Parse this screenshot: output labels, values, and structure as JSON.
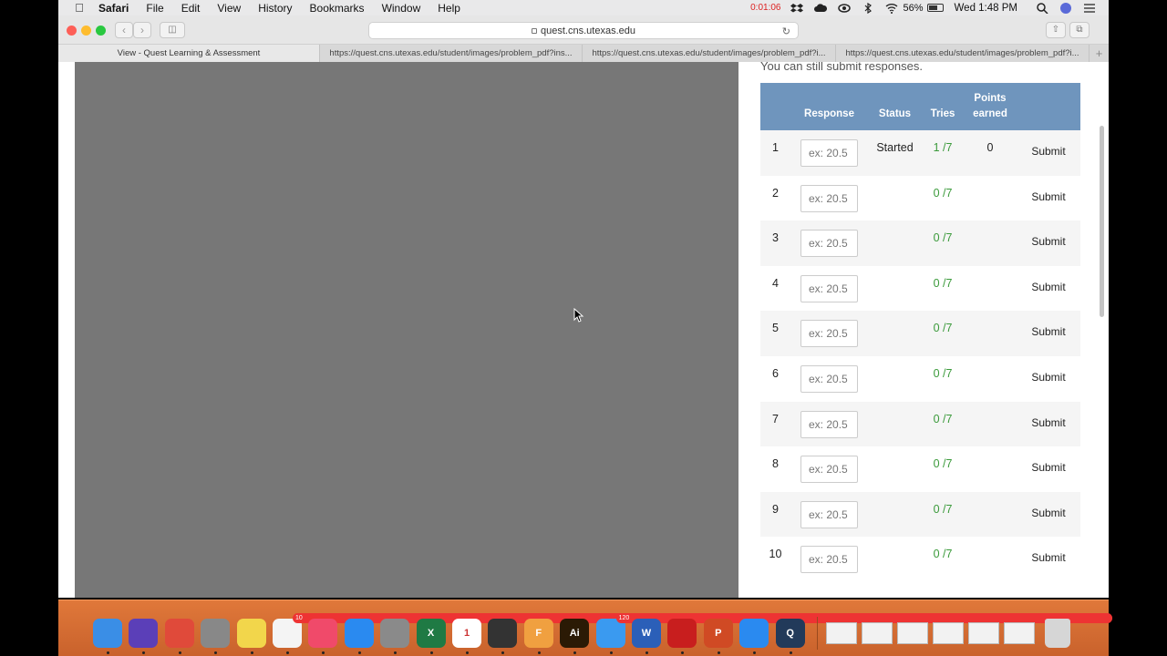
{
  "menubar": {
    "app": "Safari",
    "items": [
      "File",
      "Edit",
      "View",
      "History",
      "Bookmarks",
      "Window",
      "Help"
    ],
    "timer": "0:01:06",
    "battery": "56%",
    "clock": "Wed 1:48 PM"
  },
  "browser": {
    "url": "quest.cns.utexas.edu",
    "tabs": [
      {
        "title": "View - Quest Learning & Assessment",
        "active": true
      },
      {
        "title": "https://quest.cns.utexas.edu/student/images/problem_pdf?ins...",
        "active": false
      },
      {
        "title": "https://quest.cns.utexas.edu/student/images/problem_pdf?i...",
        "active": false
      },
      {
        "title": "https://quest.cns.utexas.edu/student/images/problem_pdf?i...",
        "active": false
      }
    ],
    "new_tab_label": "+"
  },
  "page": {
    "notice": "You can still submit responses.",
    "table": {
      "headers": {
        "response": "Response",
        "status": "Status",
        "tries": "Tries",
        "points_line1": "Points",
        "points_line2": "earned"
      },
      "placeholder": "ex: 20.5",
      "submit_label": "Submit",
      "rows": [
        {
          "num": "1",
          "status": "Started",
          "tries": "1 /7",
          "points": "0"
        },
        {
          "num": "2",
          "status": "",
          "tries": "0 /7",
          "points": ""
        },
        {
          "num": "3",
          "status": "",
          "tries": "0 /7",
          "points": ""
        },
        {
          "num": "4",
          "status": "",
          "tries": "0 /7",
          "points": ""
        },
        {
          "num": "5",
          "status": "",
          "tries": "0 /7",
          "points": ""
        },
        {
          "num": "6",
          "status": "",
          "tries": "0 /7",
          "points": ""
        },
        {
          "num": "7",
          "status": "",
          "tries": "0 /7",
          "points": ""
        },
        {
          "num": "8",
          "status": "",
          "tries": "0 /7",
          "points": ""
        },
        {
          "num": "9",
          "status": "",
          "tries": "0 /7",
          "points": ""
        },
        {
          "num": "10",
          "status": "",
          "tries": "0 /7",
          "points": ""
        }
      ]
    }
  },
  "dock": {
    "apps": [
      {
        "name": "finder-icon",
        "color": "#3a8ee6",
        "label": ""
      },
      {
        "name": "siri-icon",
        "color": "#5b3fb8",
        "label": ""
      },
      {
        "name": "chrome-icon",
        "color": "#e04a3a",
        "label": ""
      },
      {
        "name": "launchpad-icon",
        "color": "#888888",
        "label": ""
      },
      {
        "name": "notes-icon",
        "color": "#f2d64b",
        "label": ""
      },
      {
        "name": "reminders-icon",
        "color": "#f4f4f4",
        "label": "",
        "badge": "10"
      },
      {
        "name": "music-icon",
        "color": "#f04a6a",
        "label": ""
      },
      {
        "name": "app-store-icon",
        "color": "#2a8af0",
        "label": ""
      },
      {
        "name": "system-preferences-icon",
        "color": "#8a8a8a",
        "label": ""
      },
      {
        "name": "excel-icon",
        "color": "#1f7a44",
        "label": "X"
      },
      {
        "name": "calendar-icon",
        "color": "#ffffff",
        "label": "1"
      },
      {
        "name": "final-cut-icon",
        "color": "#333333",
        "label": ""
      },
      {
        "name": "flux-icon",
        "color": "#f0a040",
        "label": "F"
      },
      {
        "name": "illustrator-icon",
        "color": "#2b1a05",
        "label": "Ai"
      },
      {
        "name": "messages-icon",
        "color": "#3a9af0",
        "label": "",
        "badge": "120"
      },
      {
        "name": "word-icon",
        "color": "#2b5fb8",
        "label": "W"
      },
      {
        "name": "acrobat-icon",
        "color": "#c81e1e",
        "label": ""
      },
      {
        "name": "powerpoint-icon",
        "color": "#d04a24",
        "label": "P"
      },
      {
        "name": "safari-icon",
        "color": "#2a8af0",
        "label": ""
      },
      {
        "name": "quicktime-icon",
        "color": "#223a5a",
        "label": "Q"
      }
    ]
  }
}
